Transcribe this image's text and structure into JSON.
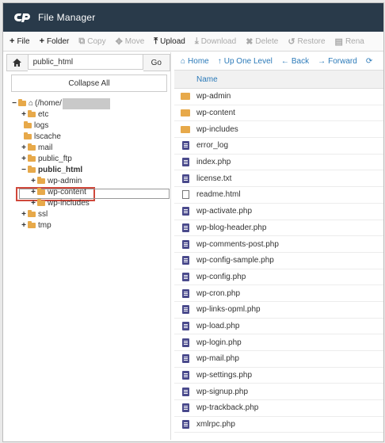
{
  "app": {
    "title": "File Manager"
  },
  "toolbar": [
    {
      "icon": "plus-icon",
      "glyph": "+",
      "label": "File",
      "enabled": true
    },
    {
      "icon": "plus-icon",
      "glyph": "+",
      "label": "Folder",
      "enabled": true
    },
    {
      "icon": "copy-icon",
      "glyph": "⧉",
      "label": "Copy",
      "enabled": false
    },
    {
      "icon": "move-icon",
      "glyph": "✥",
      "label": "Move",
      "enabled": false
    },
    {
      "icon": "upload-icon",
      "glyph": "⤒",
      "label": "Upload",
      "enabled": true
    },
    {
      "icon": "download-icon",
      "glyph": "⤓",
      "label": "Download",
      "enabled": false
    },
    {
      "icon": "delete-icon",
      "glyph": "✖",
      "label": "Delete",
      "enabled": false
    },
    {
      "icon": "restore-icon",
      "glyph": "↺",
      "label": "Restore",
      "enabled": false
    },
    {
      "icon": "rename-icon",
      "glyph": "▤",
      "label": "Rena",
      "enabled": false
    }
  ],
  "path": {
    "value": "public_html",
    "go_label": "Go"
  },
  "collapse_label": "Collapse All",
  "tree": [
    {
      "toggle": "−",
      "label": "(/home/",
      "root": true
    },
    {
      "toggle": "+",
      "label": "etc"
    },
    {
      "toggle": "",
      "label": "logs"
    },
    {
      "toggle": "",
      "label": "lscache"
    },
    {
      "toggle": "+",
      "label": "mail"
    },
    {
      "toggle": "+",
      "label": "public_ftp"
    },
    {
      "toggle": "−",
      "label": "public_html",
      "selected": true
    },
    {
      "toggle": "+",
      "label": "wp-admin"
    },
    {
      "toggle": "+",
      "label": "wp-content"
    },
    {
      "toggle": "+",
      "label": "wp-includes"
    },
    {
      "toggle": "+",
      "label": "ssl"
    },
    {
      "toggle": "+",
      "label": "tmp"
    }
  ],
  "nav": [
    {
      "icon": "home-icon",
      "glyph": "⌂",
      "label": "Home"
    },
    {
      "icon": "up-arrow-icon",
      "glyph": "↑",
      "label": "Up One Level"
    },
    {
      "icon": "back-arrow-icon",
      "glyph": "←",
      "label": "Back"
    },
    {
      "icon": "forward-arrow-icon",
      "glyph": "→",
      "label": "Forward"
    },
    {
      "icon": "reload-icon",
      "glyph": "⟳",
      "label": ""
    }
  ],
  "column_header": "Name",
  "files": [
    {
      "name": "wp-admin",
      "type": "dir"
    },
    {
      "name": "wp-content",
      "type": "dir"
    },
    {
      "name": "wp-includes",
      "type": "dir"
    },
    {
      "name": "error_log",
      "type": "file"
    },
    {
      "name": "index.php",
      "type": "file"
    },
    {
      "name": "license.txt",
      "type": "file"
    },
    {
      "name": "readme.html",
      "type": "html"
    },
    {
      "name": "wp-activate.php",
      "type": "file"
    },
    {
      "name": "wp-blog-header.php",
      "type": "file"
    },
    {
      "name": "wp-comments-post.php",
      "type": "file"
    },
    {
      "name": "wp-config-sample.php",
      "type": "file"
    },
    {
      "name": "wp-config.php",
      "type": "file"
    },
    {
      "name": "wp-cron.php",
      "type": "file"
    },
    {
      "name": "wp-links-opml.php",
      "type": "file"
    },
    {
      "name": "wp-load.php",
      "type": "file"
    },
    {
      "name": "wp-login.php",
      "type": "file"
    },
    {
      "name": "wp-mail.php",
      "type": "file"
    },
    {
      "name": "wp-settings.php",
      "type": "file"
    },
    {
      "name": "wp-signup.php",
      "type": "file"
    },
    {
      "name": "wp-trackback.php",
      "type": "file"
    },
    {
      "name": "xmlrpc.php",
      "type": "file"
    }
  ]
}
